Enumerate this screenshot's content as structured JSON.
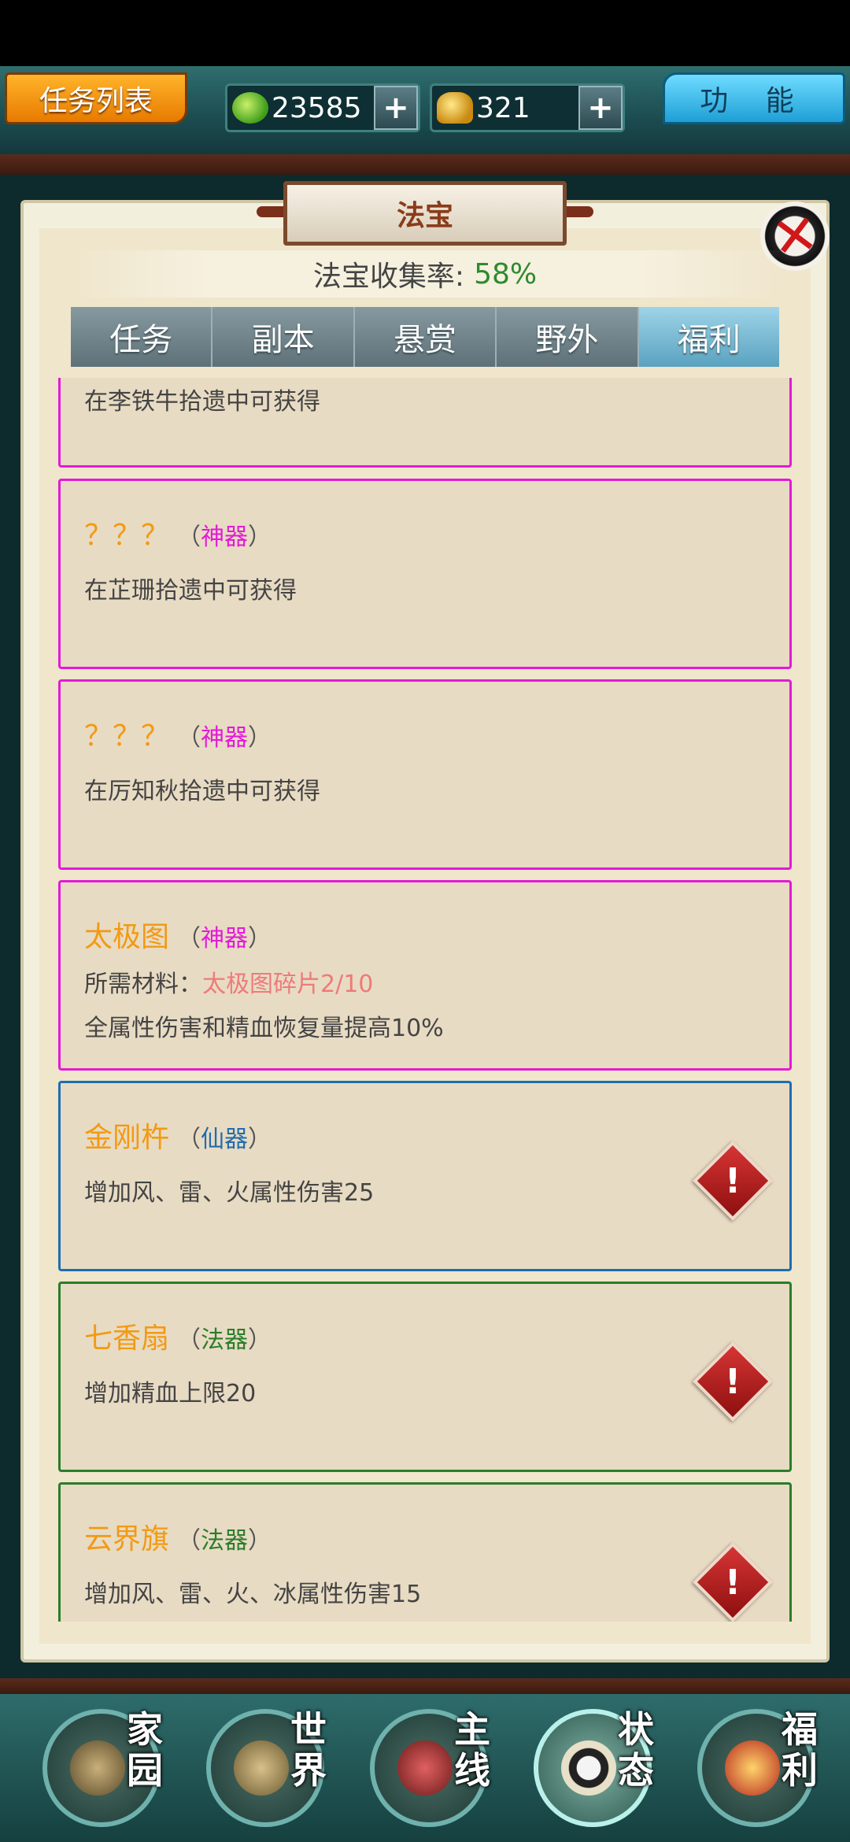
{
  "hud": {
    "task_list_label": "任务列表",
    "function_label": "功 能",
    "jade_value": "23585",
    "gold_value": "321",
    "plus": "+"
  },
  "panel": {
    "title": "法宝",
    "close_glyph": "✕",
    "collection_label": "法宝收集率:",
    "collection_rate": "58%"
  },
  "tabs": [
    {
      "label": "任务",
      "active": false
    },
    {
      "label": "副本",
      "active": false
    },
    {
      "label": "悬赏",
      "active": false
    },
    {
      "label": "野外",
      "active": false
    },
    {
      "label": "福利",
      "active": true
    }
  ],
  "cards": [
    {
      "partial_line": "在李铁牛拾遗中可获得"
    },
    {
      "name": "？？？",
      "grade_open": "（",
      "grade": "神器",
      "grade_close": "）",
      "desc": "在芷珊拾遗中可获得"
    },
    {
      "name": "？？？",
      "grade_open": "（",
      "grade": "神器",
      "grade_close": "）",
      "desc": "在厉知秋拾遗中可获得"
    },
    {
      "name": "太极图",
      "grade_open": "（",
      "grade": "神器",
      "grade_close": "）",
      "material_label": "所需材料：",
      "material_value": "太极图碎片2/10",
      "desc": "全属性伤害和精血恢复量提高10%"
    },
    {
      "name": "金刚杵",
      "grade_open": "（",
      "grade": "仙器",
      "grade_close": "）",
      "desc": "增加风、雷、火属性伤害25",
      "alert": "!"
    },
    {
      "name": "七香扇",
      "grade_open": "（",
      "grade": "法器",
      "grade_close": "）",
      "desc": "增加精血上限20",
      "alert": "!"
    },
    {
      "name": "云界旗",
      "grade_open": "（",
      "grade": "法器",
      "grade_close": "）",
      "desc": "增加风、雷、火、冰属性伤害15",
      "alert": "!"
    }
  ],
  "nav": [
    {
      "label_1": "家",
      "label_2": "园",
      "icon": "home-icon"
    },
    {
      "label_1": "世",
      "label_2": "界",
      "icon": "world-map-icon"
    },
    {
      "label_1": "主",
      "label_2": "线",
      "icon": "main-quest-icon"
    },
    {
      "label_1": "状",
      "label_2": "态",
      "icon": "status-bagua-icon",
      "active": true
    },
    {
      "label_1": "福",
      "label_2": "利",
      "icon": "welfare-icon"
    }
  ],
  "colors": {
    "shenqi": "#e31ad7",
    "xianqi": "#1f6db0",
    "faqi": "#2a7d2a",
    "item_name": "#f29a14",
    "rate_green": "#2e8a2e"
  }
}
